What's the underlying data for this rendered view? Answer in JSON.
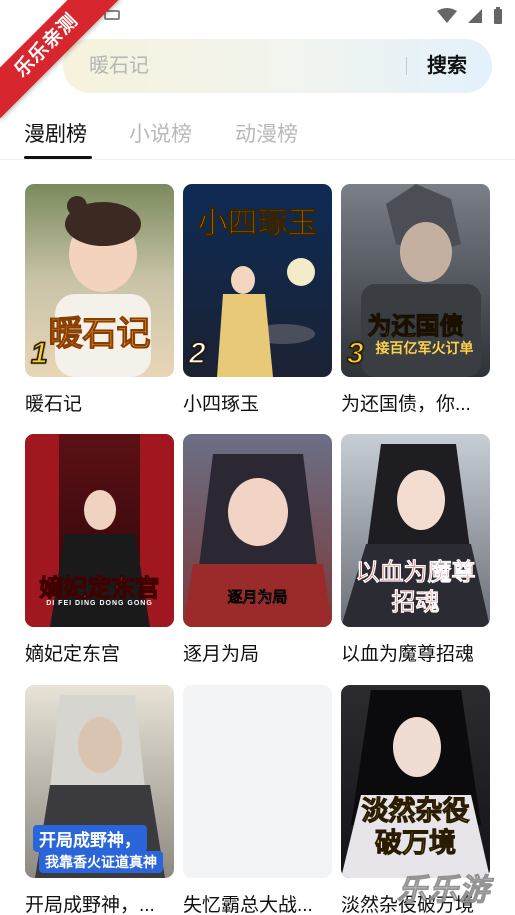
{
  "watermark_ribbon": "乐乐亲测",
  "search": {
    "placeholder": "暖石记",
    "button_label": "搜索"
  },
  "tabs": [
    {
      "label": "漫剧榜"
    },
    {
      "label": "小说榜"
    },
    {
      "label": "动漫榜"
    }
  ],
  "items": [
    {
      "title": "暖石记",
      "rank": "1",
      "cover_text": "暖石记"
    },
    {
      "title": "小四琢玉",
      "rank": "2",
      "cover_text": "小四琢玉"
    },
    {
      "title": "为还国债，你...",
      "rank": "3",
      "cover_text": "为还国债",
      "cover_subtext": "接百亿军火订单"
    },
    {
      "title": "嫡妃定东宫",
      "cover_text": "嫡妃定东宫",
      "cover_subtext": "DI FEI DING DONG GONG"
    },
    {
      "title": "逐月为局",
      "cover_text": "逐月为局"
    },
    {
      "title": "以血为魔尊招魂",
      "cover_text": "以血为魔尊招魂"
    },
    {
      "title": "开局成野神，...",
      "cover_text": "开局成野神，",
      "cover_subtext": "我靠香火证道真神"
    },
    {
      "title": "失忆霸总大战..."
    },
    {
      "title": "淡然杂役破万境",
      "cover_text": "淡然杂役破万境"
    }
  ],
  "bottom_watermark": {
    "text": "乐乐游戏"
  },
  "colors": {
    "accent_red": "#d8262e",
    "tab_active": "#111111",
    "tab_inactive": "#b9b9b9"
  }
}
